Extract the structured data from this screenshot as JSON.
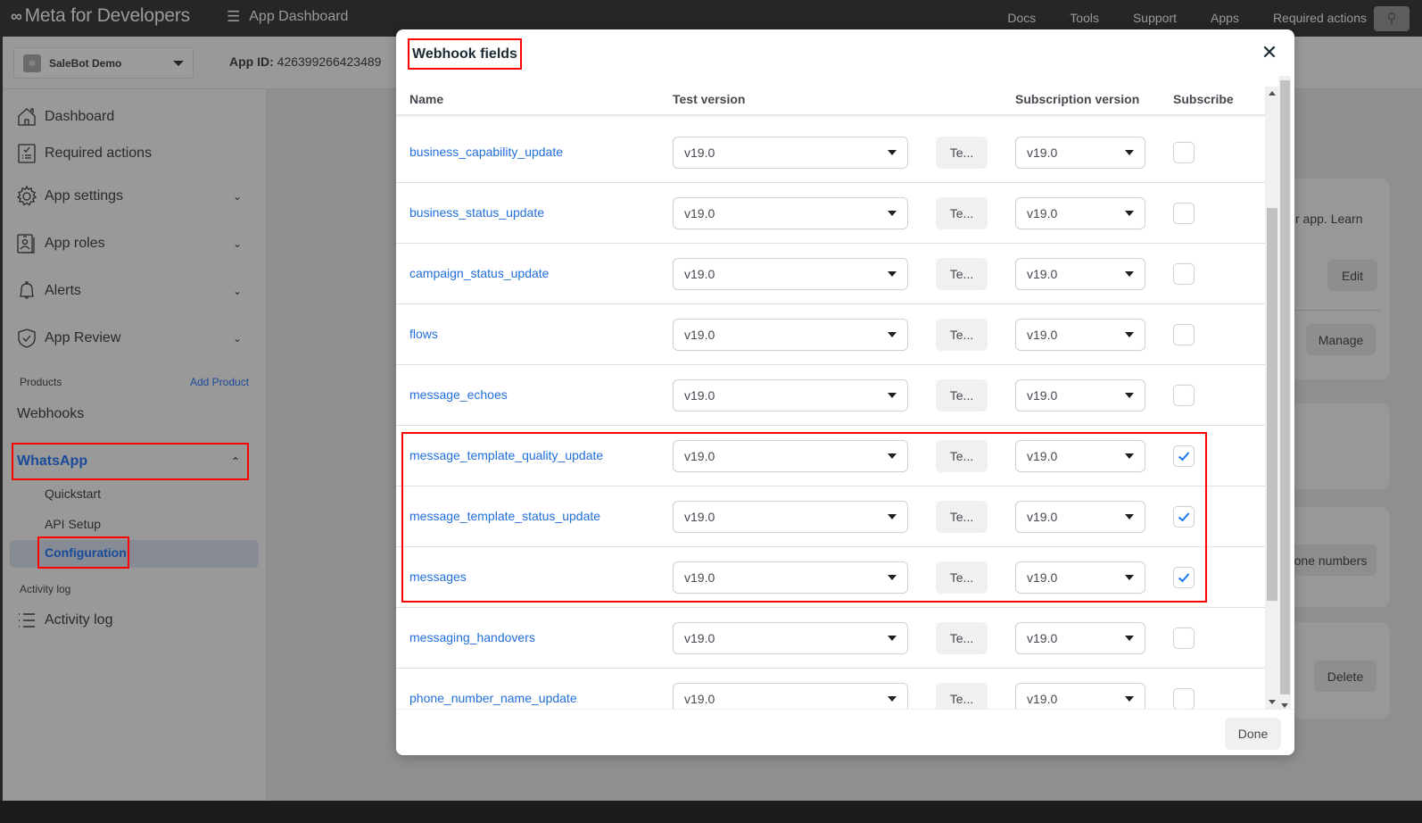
{
  "topbar": {
    "brand": "Meta for Developers",
    "menu_label": "App Dashboard",
    "nav": [
      "Docs",
      "Tools",
      "Support",
      "Apps",
      "Required actions"
    ]
  },
  "appbar": {
    "app_name": "SaleBot Demo",
    "app_id_label": "App ID:",
    "app_id_value": "426399266423489"
  },
  "sidebar": {
    "items": [
      {
        "label": "Dashboard",
        "icon": "home-icon",
        "expandable": false
      },
      {
        "label": "Required actions",
        "icon": "checklist-icon",
        "expandable": false
      },
      {
        "label": "App settings",
        "icon": "gear-icon",
        "expandable": true
      },
      {
        "label": "App roles",
        "icon": "badge-icon",
        "expandable": true
      },
      {
        "label": "Alerts",
        "icon": "bell-icon",
        "expandable": true
      },
      {
        "label": "App Review",
        "icon": "shield-check-icon",
        "expandable": true
      }
    ],
    "products_label": "Products",
    "add_product": "Add Product",
    "webhooks": "Webhooks",
    "whatsapp": "WhatsApp",
    "whatsapp_sub": [
      "Quickstart",
      "API Setup",
      "Configuration"
    ],
    "activity_section": "Activity log",
    "activity_item": "Activity log"
  },
  "background_cards": {
    "text_learn": "r app. Learn",
    "edit": "Edit",
    "manage": "Manage",
    "phone_numbers": "one numbers",
    "delete": "Delete"
  },
  "modal": {
    "title": "Webhook fields",
    "columns": {
      "name": "Name",
      "test_version": "Test version",
      "subscription_version": "Subscription version",
      "subscribe": "Subscribe"
    },
    "test_button_label": "Te...",
    "rows": [
      {
        "name": "business_capability_update",
        "test_version": "v19.0",
        "subscription_version": "v19.0",
        "subscribed": false
      },
      {
        "name": "business_status_update",
        "test_version": "v19.0",
        "subscription_version": "v19.0",
        "subscribed": false
      },
      {
        "name": "campaign_status_update",
        "test_version": "v19.0",
        "subscription_version": "v19.0",
        "subscribed": false
      },
      {
        "name": "flows",
        "test_version": "v19.0",
        "subscription_version": "v19.0",
        "subscribed": false
      },
      {
        "name": "message_echoes",
        "test_version": "v19.0",
        "subscription_version": "v19.0",
        "subscribed": false
      },
      {
        "name": "message_template_quality_update",
        "test_version": "v19.0",
        "subscription_version": "v19.0",
        "subscribed": true
      },
      {
        "name": "message_template_status_update",
        "test_version": "v19.0",
        "subscription_version": "v19.0",
        "subscribed": true
      },
      {
        "name": "messages",
        "test_version": "v19.0",
        "subscription_version": "v19.0",
        "subscribed": true
      },
      {
        "name": "messaging_handovers",
        "test_version": "v19.0",
        "subscription_version": "v19.0",
        "subscribed": false
      },
      {
        "name": "phone_number_name_update",
        "test_version": "v19.0",
        "subscription_version": "v19.0",
        "subscribed": false
      }
    ],
    "done": "Done"
  },
  "colors": {
    "link": "#216fdb",
    "checkbox_check": "#1877f2",
    "annotation": "#ff0000",
    "nav_active": "#1a4a9a"
  }
}
